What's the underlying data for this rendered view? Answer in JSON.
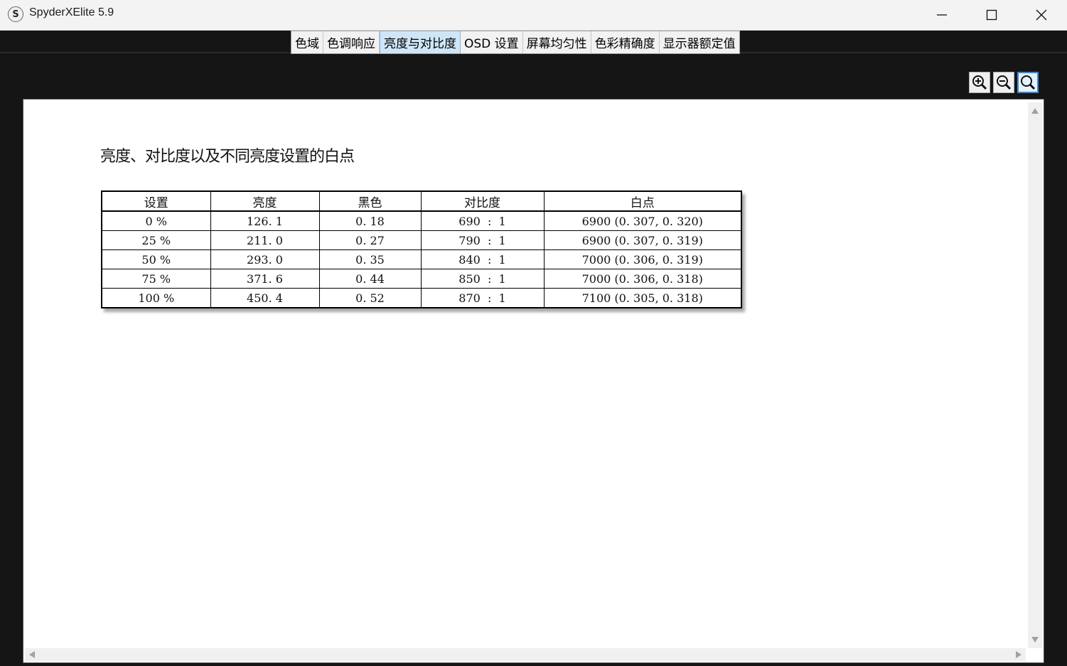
{
  "window": {
    "title": "SpyderXElite 5.9",
    "icon_letter": "S",
    "minimize_icon": "minimize-icon",
    "maximize_icon": "maximize-icon",
    "close_icon": "close-icon"
  },
  "tabs": [
    {
      "label": "色域",
      "active": false
    },
    {
      "label": "色调响应",
      "active": false
    },
    {
      "label": "亮度与对比度",
      "active": true
    },
    {
      "label": "OSD 设置",
      "active": false
    },
    {
      "label": "屏幕均匀性",
      "active": false
    },
    {
      "label": "色彩精确度",
      "active": false
    },
    {
      "label": "显示器额定值",
      "active": false
    }
  ],
  "zoom_tools": [
    "zoom-in-icon",
    "zoom-out-icon",
    "zoom-fit-icon"
  ],
  "report": {
    "title": "亮度、对比度以及不同亮度设置的白点",
    "columns": [
      "设置",
      "亮度",
      "黑色",
      "对比度",
      "白点"
    ],
    "rows": [
      [
        "0 %",
        "126. 1",
        "0. 18",
        "690  :  1",
        "6900 (0. 307, 0. 320)"
      ],
      [
        "25 %",
        "211. 0",
        "0. 27",
        "790  :  1",
        "6900 (0. 307, 0. 319)"
      ],
      [
        "50 %",
        "293. 0",
        "0. 35",
        "840  :  1",
        "7000 (0. 306, 0. 319)"
      ],
      [
        "75 %",
        "371. 6",
        "0. 44",
        "850  :  1",
        "7000 (0. 306, 0. 318)"
      ],
      [
        "100 %",
        "450. 4",
        "0. 52",
        "870  :  1",
        "7100 (0. 305, 0. 318)"
      ]
    ]
  },
  "colors": {
    "active_tab": "#cfe6f8",
    "background_dark": "#151515"
  }
}
